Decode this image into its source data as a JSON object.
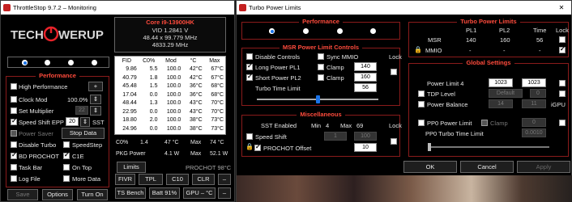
{
  "ts": {
    "title": "ThrottleStop 9.7.2 – Monitoring",
    "logo": "TECHPOWERUP",
    "core": "Core i9-13900HK",
    "vid_label": "VID",
    "vid": "1.2841 V",
    "freq1": "48.44 x 99.779 MHz",
    "freq2": "4833.29 MHz",
    "perf_header": "Performance",
    "options": [
      {
        "label": "High Performance",
        "checked": false
      },
      {
        "label": "Clock Mod",
        "checked": false,
        "value": "100.0%"
      },
      {
        "label": "Set Multiplier",
        "checked": false,
        "value": "22"
      },
      {
        "label": "Speed Shift EPP",
        "checked": true,
        "value": "20",
        "suffix": "SST"
      },
      {
        "label": "Power Saver",
        "checked": false,
        "disabled": true
      },
      {
        "label": "Disable Turbo",
        "checked": false
      },
      {
        "label": "BD PROCHOT",
        "checked": true
      },
      {
        "label": "Task Bar",
        "checked": false
      },
      {
        "label": "Log File",
        "checked": false
      }
    ],
    "options_right": [
      {
        "label": "Stop Data"
      },
      {
        "label": "SpeedStep",
        "checked": false
      },
      {
        "label": "C1E",
        "checked": true
      },
      {
        "label": "On Top",
        "checked": false
      },
      {
        "label": "More Data",
        "checked": false
      }
    ],
    "plus": "+",
    "table_headers": [
      "FID",
      "C0%",
      "Mod",
      "°C",
      "Max"
    ],
    "table_rows": [
      [
        "9.86",
        "5.5",
        "100.0",
        "42°C",
        "67°C"
      ],
      [
        "40.79",
        "1.8",
        "100.0",
        "42°C",
        "67°C"
      ],
      [
        "45.48",
        "1.5",
        "100.0",
        "36°C",
        "68°C"
      ],
      [
        "17.04",
        "0.0",
        "100.0",
        "36°C",
        "68°C"
      ],
      [
        "48.44",
        "1.3",
        "100.0",
        "43°C",
        "70°C"
      ],
      [
        "22.95",
        "0.0",
        "100.0",
        "43°C",
        "70°C"
      ],
      [
        "18.80",
        "2.0",
        "100.0",
        "38°C",
        "73°C"
      ],
      [
        "24.96",
        "0.0",
        "100.0",
        "38°C",
        "73°C"
      ]
    ],
    "c0_label": "C0%",
    "c0": "1.4",
    "c0_unit": "47 °C",
    "max_label": "Max",
    "max": "74 °C",
    "pkg_label": "PKG Power",
    "pkg": "4.1 W",
    "pkg_max_label": "Max",
    "pkg_max": "52.1 W",
    "limits": "Limits",
    "prochot": "PROCHOT 98°C",
    "bottom_btns": [
      "Save",
      "Options",
      "Turn On"
    ],
    "tool_btns": [
      "FIVR",
      "TPL",
      "C10",
      "CLR",
      "–"
    ],
    "bench_btns": [
      "TS Bench",
      "Batt 91%",
      "GPU – °C",
      "–"
    ]
  },
  "tpl": {
    "title": "Turbo Power Limits",
    "perf": "Performance",
    "turbo_header": "Turbo Power Limits",
    "cols": [
      "PL1",
      "PL2",
      "Time",
      "Lock"
    ],
    "msr": {
      "label": "MSR",
      "pl1": "140",
      "pl2": "160",
      "time": "56"
    },
    "mmio": {
      "label": "MMIO",
      "pl1": "-",
      "pl2": "-",
      "time": "-"
    },
    "msr_header": "MSR Power Limit Controls",
    "disable_controls": "Disable Controls",
    "sync_mmio": "Sync MMIO",
    "lock": "Lock",
    "long_pl1": "Long Power PL1",
    "short_pl2": "Short Power PL2",
    "clamp": "Clamp",
    "pl1_val": "140",
    "pl2_val": "160",
    "turbo_time": "Turbo Time Limit",
    "turbo_time_val": "56",
    "misc_header": "Miscellaneous",
    "sst_enabled": "SST Enabled",
    "min_label": "Min",
    "min": "4",
    "max_label": "Max",
    "max": "69",
    "speed_shift": "Speed Shift",
    "speed_shift_val": "1",
    "speed_shift_val2": "100",
    "prochot_offset": "PROCHOT Offset",
    "prochot_val": "10",
    "global_header": "Global Settings",
    "power_limit4": "Power Limit 4",
    "pl4_a": "1023",
    "pl4_b": "1023",
    "tdp_level": "TDP Level",
    "tdp_val": "Default",
    "tdp_b": "0",
    "power_balance": "Power Balance",
    "pb_a": "14",
    "pb_b": "11",
    "igpu": "iGPU",
    "pp0": "PP0 Power Limit",
    "pp0_clamp": "Clamp",
    "pp0_val": "0",
    "pp0_time": "PP0 Turbo Time Limit",
    "pp0_time_val": "0.0010",
    "ok": "OK",
    "cancel": "Cancel",
    "apply": "Apply"
  }
}
